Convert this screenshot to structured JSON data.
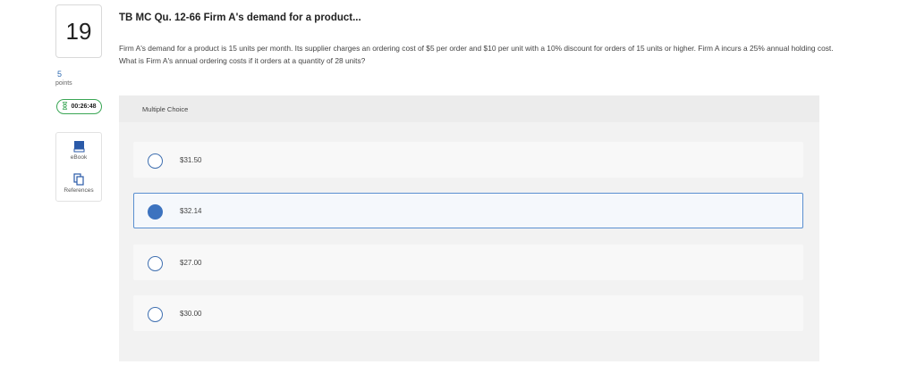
{
  "question": {
    "number": "19",
    "points_value": "5",
    "points_label": "points",
    "timer": "00:26:48",
    "title": "TB MC Qu. 12-66 Firm A's demand for a product...",
    "text": "Firm A's demand for a product is 15 units per month. Its supplier charges an ordering cost of $5 per order and $10 per unit with a 10% discount for orders of 15 units or higher. Firm A incurs a 25% annual holding cost. What is Firm A's annual ordering costs if it orders at a quantity of 28 units?"
  },
  "tools": {
    "ebook_label": "eBook",
    "references_label": "References"
  },
  "multiple_choice": {
    "label": "Multiple Choice",
    "options": [
      {
        "label": "$31.50",
        "selected": false
      },
      {
        "label": "$32.14",
        "selected": true
      },
      {
        "label": "$27.00",
        "selected": false
      },
      {
        "label": "$30.00",
        "selected": false
      }
    ]
  },
  "colors": {
    "accent": "#3d73bf",
    "timer_border": "#3aa655"
  },
  "icons": [
    "hourglass-icon",
    "ebook-icon",
    "references-icon",
    "radio-icon"
  ]
}
